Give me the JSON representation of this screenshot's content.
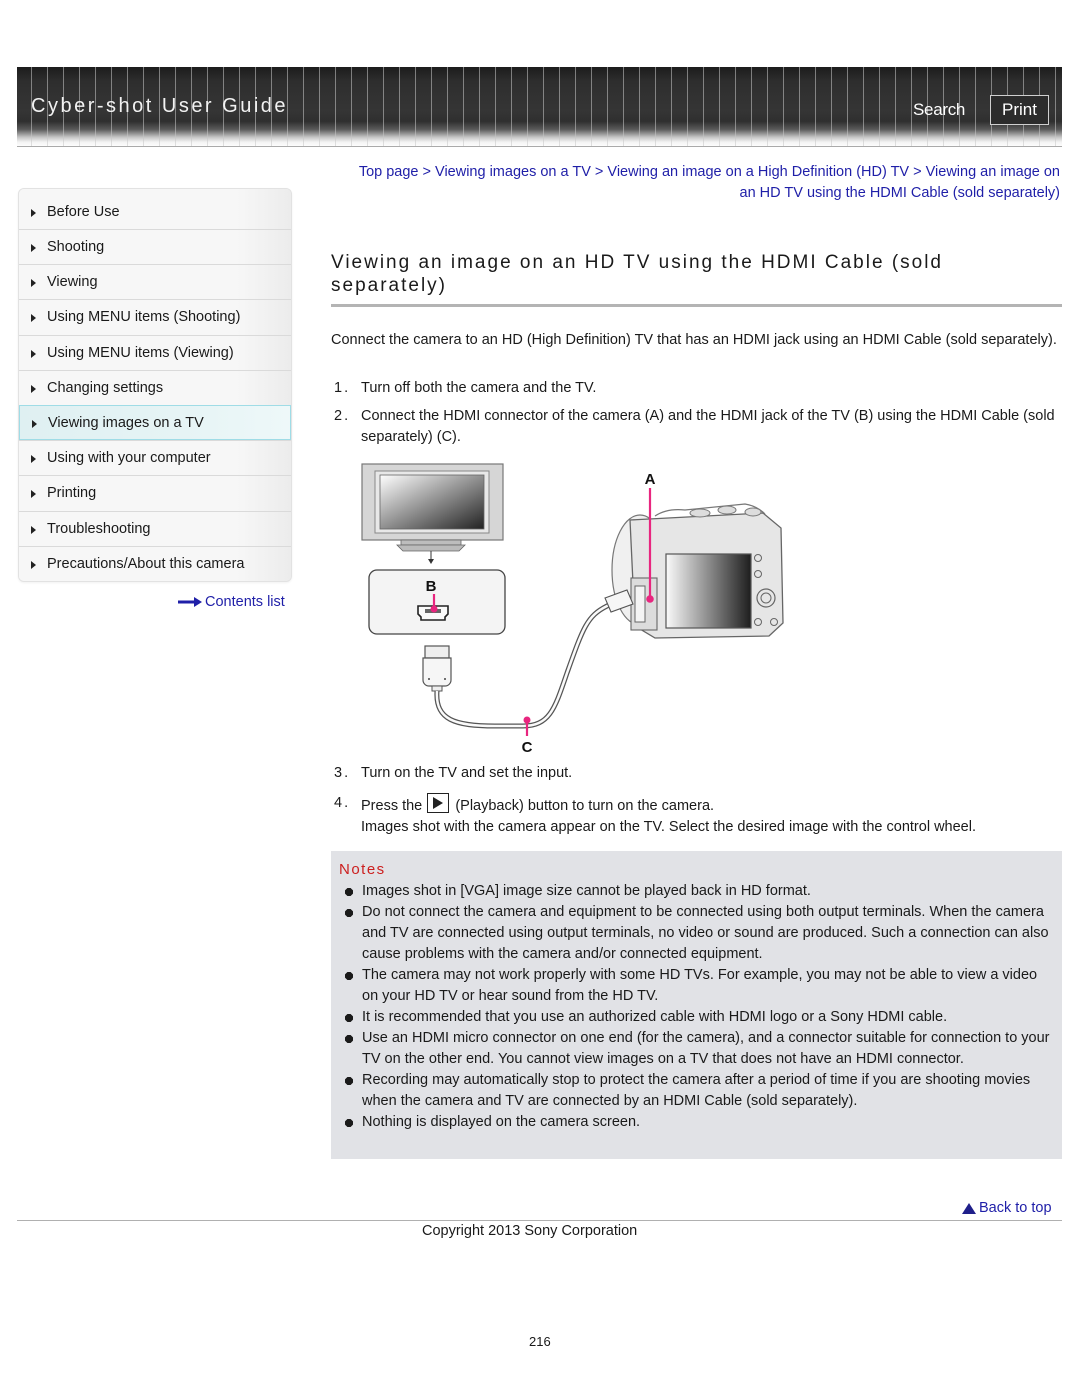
{
  "header": {
    "title": "Cyber-shot User Guide",
    "search_label": "Search",
    "print_label": "Print"
  },
  "sidebar": {
    "items": [
      {
        "label": "Before Use",
        "active": false
      },
      {
        "label": "Shooting",
        "active": false
      },
      {
        "label": "Viewing",
        "active": false
      },
      {
        "label": "Using MENU items (Shooting)",
        "active": false
      },
      {
        "label": "Using MENU items (Viewing)",
        "active": false
      },
      {
        "label": "Changing settings",
        "active": false
      },
      {
        "label": "Viewing images on a TV",
        "active": true
      },
      {
        "label": "Using with your computer",
        "active": false
      },
      {
        "label": "Printing",
        "active": false
      },
      {
        "label": "Troubleshooting",
        "active": false
      },
      {
        "label": "Precautions/About this camera",
        "active": false
      }
    ],
    "contents_link": "Contents list"
  },
  "breadcrumb": {
    "items": [
      "Top page",
      "Viewing images on a TV",
      "Viewing an image on a High Definition (HD) TV",
      "Viewing an image on an HD TV using the HDMI Cable (sold separately)"
    ],
    "separator": ">"
  },
  "page": {
    "title": "Viewing an image on an HD TV using the HDMI Cable (sold separately)",
    "intro": "Connect the camera to an HD (High Definition) TV that has an HDMI jack using an HDMI Cable (sold separately).",
    "steps": [
      {
        "num": "1.",
        "text": "Turn off both the camera and the TV."
      },
      {
        "num": "2.",
        "text": "Connect the HDMI connector of the camera (A) and the HDMI jack of the TV (B) using the HDMI Cable (sold separately) (C)."
      },
      {
        "num": "3.",
        "text": "Turn on the TV and set the input."
      },
      {
        "num": "4.",
        "text_before": "Press the",
        "text_after": "(Playback) button to turn on the camera.",
        "subtext": "Images shot with the camera appear on the TV. Select the desired image with the control wheel."
      }
    ],
    "diagram": {
      "label_a": "A",
      "label_b": "B",
      "label_c": "C",
      "accent_color": "#e8267f"
    }
  },
  "notes": {
    "title": "Notes",
    "items": [
      "Images shot in [VGA] image size cannot be played back in HD format.",
      "Do not connect the camera and equipment to be connected using both output terminals. When the camera and TV are connected using output terminals, no video or sound are produced. Such a connection can also cause problems with the camera and/or connected equipment.",
      "The camera may not work properly with some HD TVs. For example, you may not be able to view a video on your HD TV or hear sound from the HD TV.",
      "It is recommended that you use an authorized cable with HDMI logo or a Sony HDMI cable.",
      "Use an HDMI micro connector on one end (for the camera), and a connector suitable for connection to your TV on the other end. You cannot view images on a TV that does not have an HDMI connector.",
      "Recording may automatically stop to protect the camera after a period of time if you are shooting movies when the camera and TV are connected by an HDMI Cable (sold separately).",
      "Nothing is displayed on the camera screen."
    ]
  },
  "footer": {
    "back_to_top": "Back to top",
    "copyright": "Copyright 2013 Sony Corporation",
    "page_number": "216"
  },
  "colors": {
    "link": "#1f1fa8",
    "notes_title": "#cc1f1f",
    "notes_bg": "#e1e2e6",
    "active_nav_bg": "#e2f2f4",
    "active_nav_border": "#9fdce6"
  }
}
